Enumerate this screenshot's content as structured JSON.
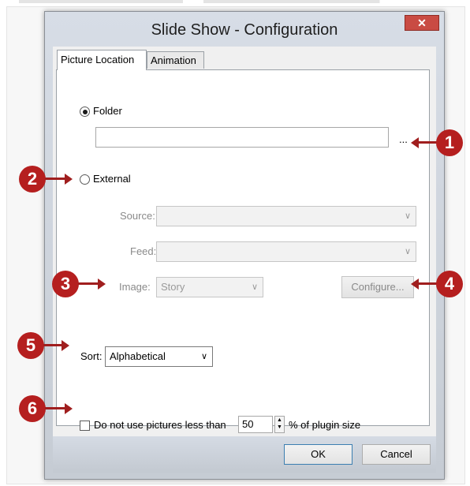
{
  "dialog": {
    "title": "Slide Show - Configuration",
    "close_glyph": "✕"
  },
  "tabs": [
    {
      "label": "Picture Location",
      "active": true
    },
    {
      "label": "Animation",
      "active": false
    }
  ],
  "picture_location": {
    "folder": {
      "label": "Folder",
      "selected": true,
      "path_value": "",
      "browse_label": "..."
    },
    "external": {
      "label": "External",
      "selected": false
    },
    "source": {
      "label": "Source:",
      "value": "",
      "enabled": false
    },
    "feed": {
      "label": "Feed:",
      "value": "",
      "enabled": false
    },
    "image": {
      "label": "Image:",
      "value": "Story",
      "enabled": false
    },
    "configure_label": "Configure...",
    "sort": {
      "label": "Sort:",
      "value": "Alphabetical"
    },
    "min_size": {
      "label": "Do not use pictures less than",
      "checked": false,
      "value": "50",
      "suffix": "% of plugin size"
    }
  },
  "footer": {
    "ok_label": "OK",
    "cancel_label": "Cancel"
  },
  "callouts": [
    "1",
    "2",
    "3",
    "4",
    "5",
    "6"
  ],
  "colors": {
    "callout": "#b51f1f",
    "close_button": "#c94b43"
  },
  "icons": {
    "dropdown": "chevron-down-icon",
    "spin": "spin-arrows-icon",
    "close": "close-icon"
  }
}
